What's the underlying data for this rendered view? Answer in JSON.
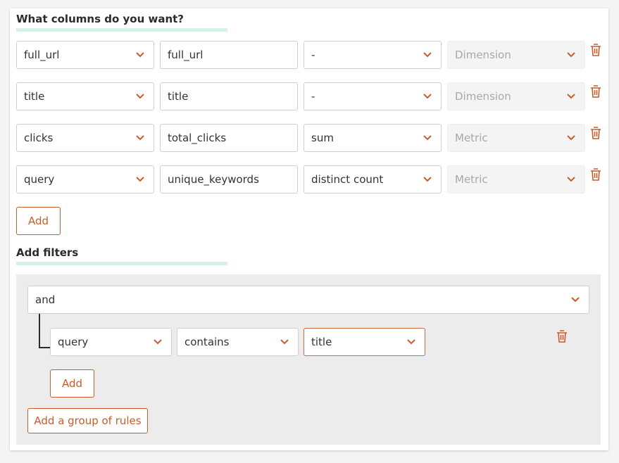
{
  "columns_section": {
    "title": "What columns do you want?",
    "rows": [
      {
        "source": "full_url",
        "name": "full_url",
        "aggregation": "-",
        "type": "Dimension"
      },
      {
        "source": "title",
        "name": "title",
        "aggregation": "-",
        "type": "Dimension"
      },
      {
        "source": "clicks",
        "name": "total_clicks",
        "aggregation": "sum",
        "type": "Metric"
      },
      {
        "source": "query",
        "name": "unique_keywords",
        "aggregation": "distinct count",
        "type": "Metric"
      }
    ],
    "add_label": "Add"
  },
  "filters_section": {
    "title": "Add filters",
    "combinator": "and",
    "rule": {
      "field": "query",
      "operator": "contains",
      "value": "title"
    },
    "add_label": "Add",
    "add_group_label": "Add a group of rules"
  },
  "colors": {
    "accent": "#c95c2b",
    "underline": "#d6f1ec",
    "panel": "#ececec",
    "disabled_text": "#a8a8a8"
  },
  "icons": {
    "dropdown": "chevron-down-icon",
    "delete": "trash-icon"
  }
}
